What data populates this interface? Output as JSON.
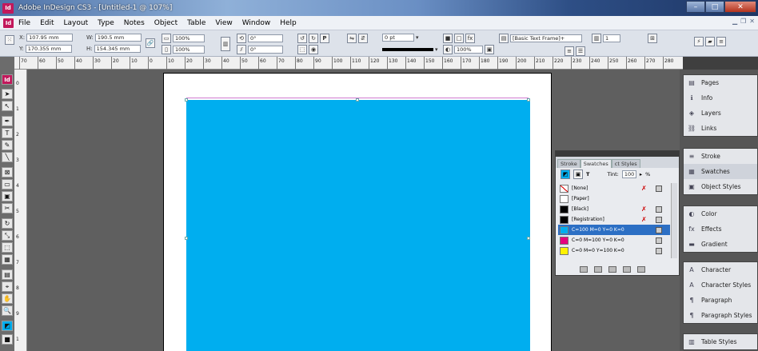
{
  "window": {
    "title": "Adobe InDesign CS3 - [Untitled-1 @ 107%]",
    "app_badge": "Id"
  },
  "menu": {
    "items": [
      "File",
      "Edit",
      "Layout",
      "Type",
      "Notes",
      "Object",
      "Table",
      "View",
      "Window",
      "Help"
    ]
  },
  "control": {
    "x_label": "X:",
    "x_value": "107.95 mm",
    "y_label": "Y:",
    "y_value": "170.355 mm",
    "w_label": "W:",
    "w_value": "190.5 mm",
    "h_label": "H:",
    "h_value": "154.345 mm",
    "scale_x": "100%",
    "scale_y": "100%",
    "rotate": "0°",
    "shear": "0°",
    "stroke_weight": "0 pt",
    "opacity": "100%",
    "frame_style": "[Basic Text Frame]+",
    "columns": "1"
  },
  "ruler_h": [
    "70",
    "60",
    "50",
    "40",
    "30",
    "20",
    "10",
    "0",
    "10",
    "20",
    "30",
    "40",
    "50",
    "60",
    "70",
    "80",
    "90",
    "100",
    "110",
    "120",
    "130",
    "140",
    "150",
    "160",
    "170",
    "180",
    "190",
    "200",
    "210",
    "220",
    "230",
    "240",
    "250",
    "260",
    "270",
    "280"
  ],
  "ruler_v": [
    "0",
    "1",
    "2",
    "3",
    "4",
    "5",
    "6",
    "7",
    "8",
    "9",
    "1"
  ],
  "swatches": {
    "tabs": [
      "Stroke",
      "Swatches",
      "ct Styles"
    ],
    "tint_label": "Tint:",
    "tint_value": "100",
    "percent": "%",
    "items": [
      {
        "name": "[None]",
        "color": "#ffffff"
      },
      {
        "name": "[Paper]",
        "color": "#ffffff"
      },
      {
        "name": "[Black]",
        "color": "#000000"
      },
      {
        "name": "[Registration]",
        "color": "#000000"
      },
      {
        "name": "C=100 M=0 Y=0 K=0",
        "color": "#00aeef"
      },
      {
        "name": "C=0 M=100 Y=0 K=0",
        "color": "#e6007e"
      },
      {
        "name": "C=0 M=0 Y=100 K=0",
        "color": "#fff200"
      }
    ]
  },
  "dock": {
    "group1": [
      "Pages",
      "Info",
      "Layers",
      "Links"
    ],
    "group2": [
      "Stroke",
      "Swatches",
      "Object Styles"
    ],
    "group3": [
      "Color",
      "Effects",
      "Gradient"
    ],
    "group4": [
      "Character",
      "Character Styles",
      "Paragraph",
      "Paragraph Styles"
    ],
    "group5": [
      "Table Styles"
    ]
  },
  "colors": {
    "frame_fill": "#00aeef",
    "accent": "#c2185b",
    "selection": "#2c6fc4"
  }
}
